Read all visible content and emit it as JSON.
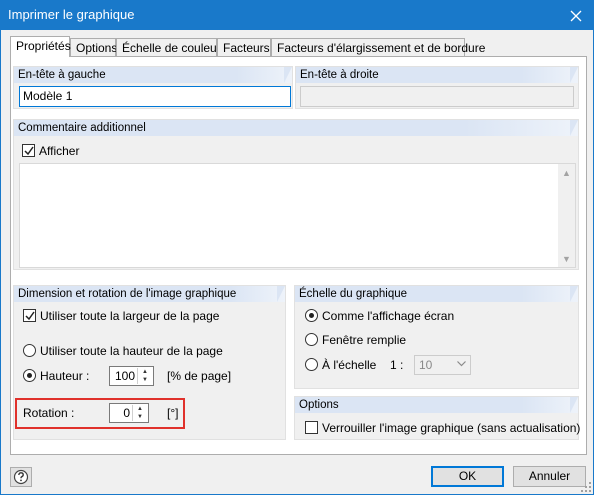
{
  "window": {
    "title": "Imprimer le graphique"
  },
  "tabs": [
    {
      "label": "Propriétés"
    },
    {
      "label": "Options"
    },
    {
      "label": "Échelle de couleur"
    },
    {
      "label": "Facteurs"
    },
    {
      "label": "Facteurs d'élargissement et de bordure"
    }
  ],
  "header_left": {
    "title": "En-tête à gauche",
    "value": "Modèle 1"
  },
  "header_right": {
    "title": "En-tête à droite",
    "value": ""
  },
  "comment": {
    "title": "Commentaire additionnel",
    "show_label": "Afficher",
    "show_checked": true,
    "text": ""
  },
  "dimension": {
    "title": "Dimension et rotation de l'image graphique",
    "full_width_label": "Utiliser toute la largeur de la page",
    "full_width_checked": true,
    "full_height_label": "Utiliser toute la hauteur de la page",
    "height_label": "Hauteur :",
    "height_value": "100",
    "height_unit": "[% de page]",
    "rotation_label": "Rotation :",
    "rotation_value": "0",
    "rotation_unit": "[°]",
    "selected_mode": "height"
  },
  "scale": {
    "title": "Échelle du graphique",
    "option_screen": "Comme l'affichage écran",
    "option_fill": "Fenêtre remplie",
    "option_scale": "À l'échelle",
    "scale_prefix": "1 :",
    "scale_value": "10",
    "selected": "screen"
  },
  "options": {
    "title": "Options",
    "lock_label": "Verrouiller l'image graphique (sans actualisation)",
    "lock_checked": false
  },
  "buttons": {
    "ok": "OK",
    "cancel": "Annuler"
  },
  "colors": {
    "titlebar": "#1979ca",
    "accent": "#0078d7",
    "highlight": "#e0312b",
    "group_header": "#dbe5f4"
  }
}
